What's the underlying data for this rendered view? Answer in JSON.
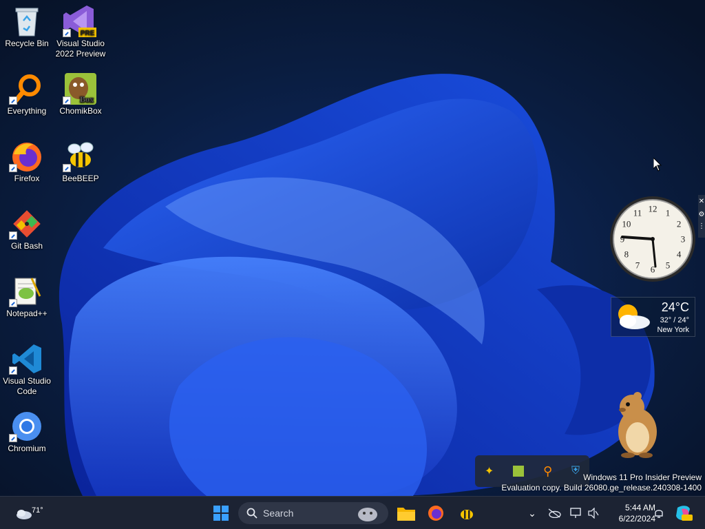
{
  "desktop_icons": [
    {
      "label": "Recycle Bin",
      "icon": "recycle-bin-icon"
    },
    {
      "label_line1": "Visual Studio",
      "label_line2": "2022 Preview",
      "badge": "PRE",
      "icon": "visual-studio-preview-icon"
    },
    {
      "label": "Everything",
      "icon": "everything-search-icon"
    },
    {
      "label": "ChomikBox",
      "badge": "Box",
      "icon": "chomikbox-icon"
    },
    {
      "label": "Firefox",
      "icon": "firefox-icon"
    },
    {
      "label": "BeeBEEP",
      "icon": "beebeep-icon"
    },
    {
      "label": "Git Bash",
      "icon": "git-bash-icon"
    },
    {
      "label": "Notepad++",
      "icon": "notepad-plus-plus-icon"
    },
    {
      "label_line1": "Visual Studio",
      "label_line2": "Code",
      "icon": "vscode-icon"
    },
    {
      "label": "Chromium",
      "icon": "chromium-icon"
    }
  ],
  "clock_gadget": {
    "numbers": [
      "12",
      "1",
      "2",
      "3",
      "4",
      "5",
      "6",
      "7",
      "8",
      "9",
      "10",
      "11"
    ]
  },
  "weather_gadget": {
    "temp": "24°C",
    "range": "32° / 24°",
    "city": "New York"
  },
  "watermark": {
    "line1": "Windows 11 Pro Insider Preview",
    "line2": "Evaluation copy. Build 26080.ge_release.240308-1400"
  },
  "taskbar": {
    "widget_temp": "71°",
    "search_placeholder": "Search",
    "time": "5:44 AM",
    "date": "6/22/2024"
  },
  "colors": {
    "taskbar_bg": "#1c2333",
    "accent": "#1e66d0",
    "wallpaper_dark": "#0a1a33"
  }
}
